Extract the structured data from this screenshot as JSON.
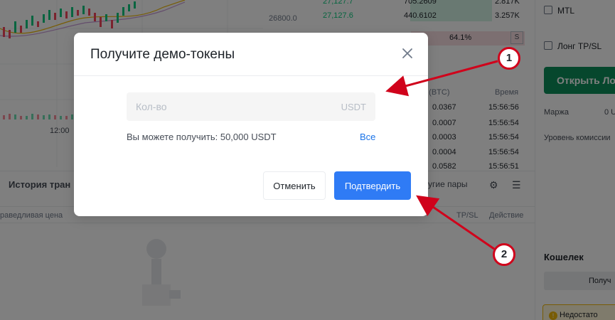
{
  "background": {
    "chart_price": "26800.0",
    "chart_time": "12:00",
    "orderbook": [
      {
        "price": "27,127.7",
        "qty": "705.2609",
        "total": "2.817K"
      },
      {
        "price": "27,127.6",
        "qty": "440.6102",
        "total": "3.257K"
      }
    ],
    "percent": "64.1%",
    "s_label": "S",
    "trades_headers": {
      "amount": "о (BTC)",
      "time": "Время"
    },
    "trades": [
      {
        "amount": "0.0367",
        "time": "15:56:56"
      },
      {
        "amount": "0.0007",
        "time": "15:56:54"
      },
      {
        "amount": "0.0003",
        "time": "15:56:54"
      },
      {
        "amount": "0.0004",
        "time": "15:56:54"
      },
      {
        "amount": "0.0582",
        "time": "15:56:51"
      }
    ],
    "right_panel": {
      "mtl": "MTL",
      "long_tpsl": "Лонг TP/SL",
      "open_button": "Открыть Лонг",
      "margin_label": "Маржа",
      "margin_value": "0 U",
      "fee_level": "Уровень комиссии",
      "wallet": "Кошелек",
      "wallet_tab": "Получ",
      "warning": "Недостато"
    },
    "history": {
      "title": "История тран",
      "other_pairs": "угие пары",
      "columns": [
        "раведливая цена",
        "TP/SL",
        "Действие"
      ]
    }
  },
  "modal": {
    "title": "Получите демо-токены",
    "amount_placeholder": "Кол-во",
    "amount_value": "",
    "unit": "USDT",
    "available_text": "Вы можете получить: 50,000 USDT",
    "all_link": "Все",
    "cancel_label": "Отменить",
    "confirm_label": "Подтвердить"
  },
  "annotations": {
    "badge_1": "1",
    "badge_2": "2",
    "color": "#d0021b"
  }
}
